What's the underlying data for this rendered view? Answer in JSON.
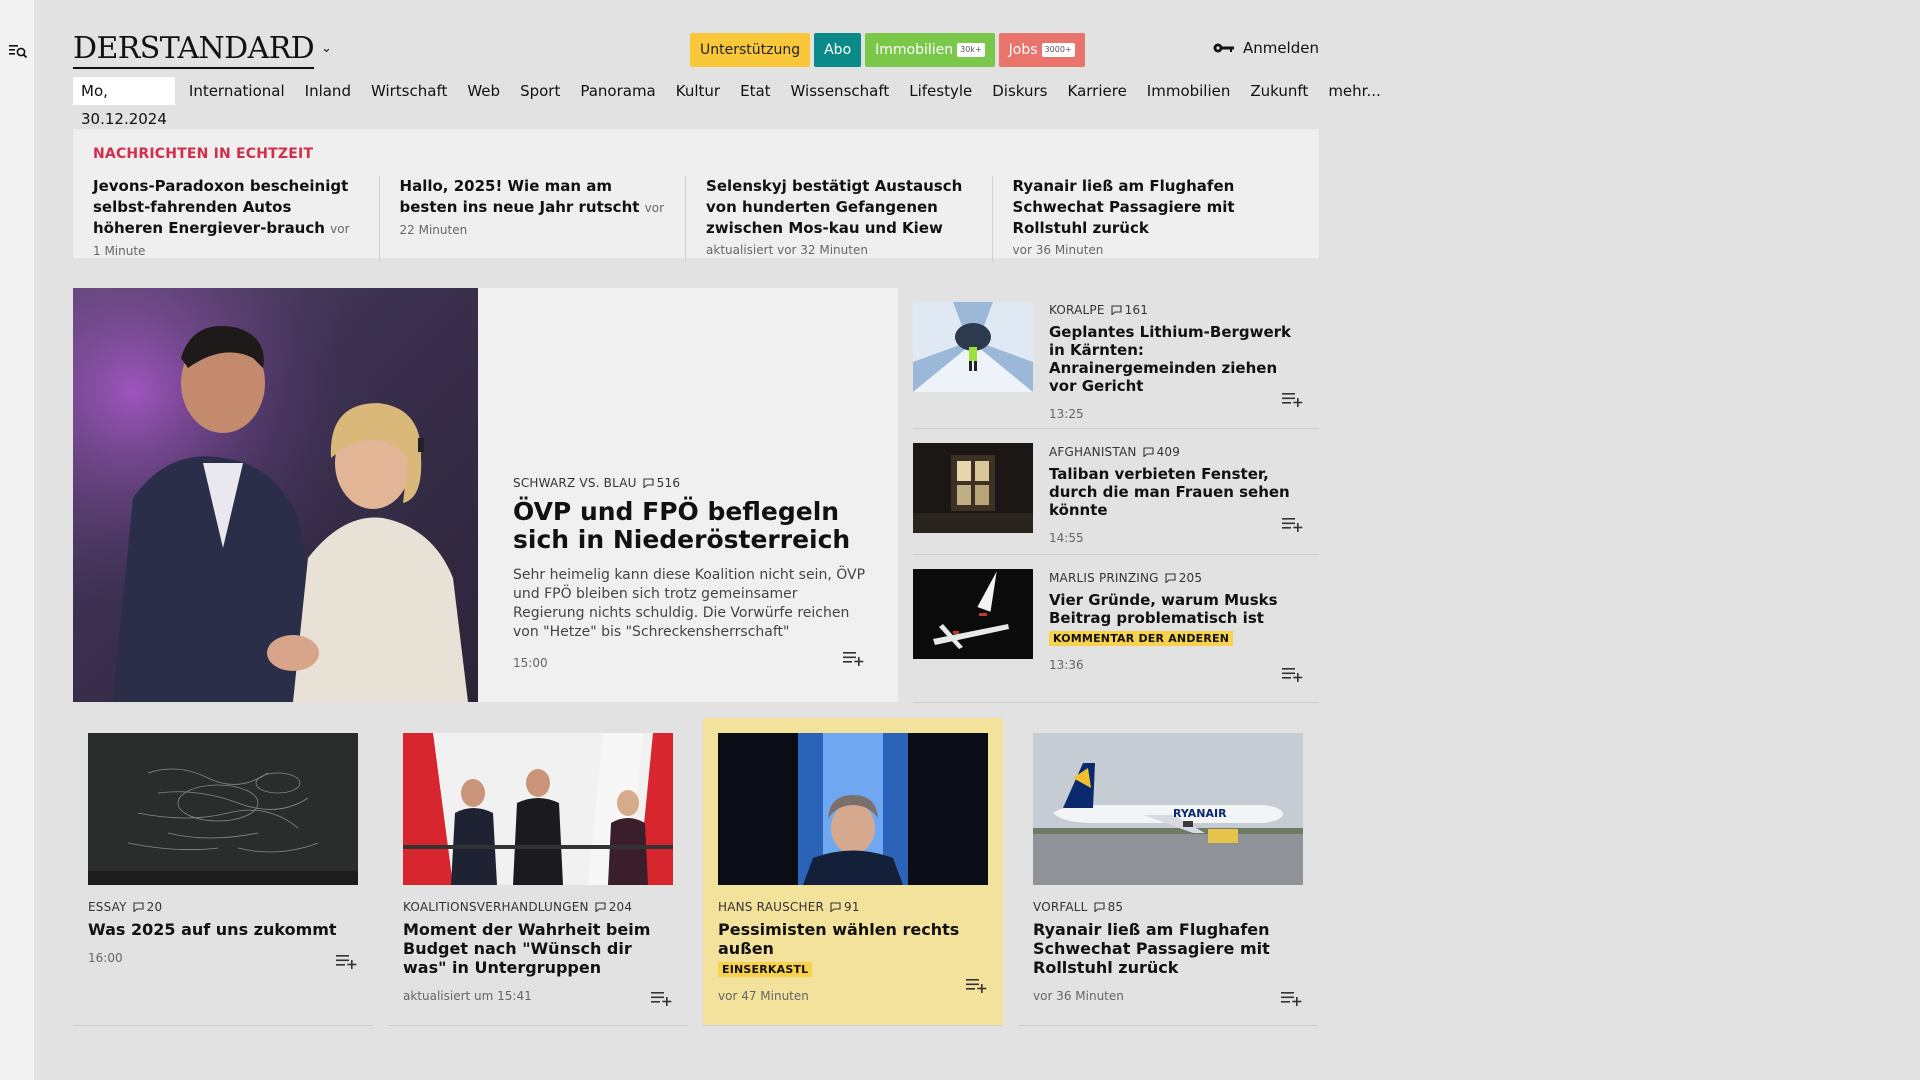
{
  "header": {
    "logo": "DERSTANDARD",
    "pills": {
      "support": "Unterstützung",
      "abo": "Abo",
      "immo": "Immobilien",
      "immo_tag": "30k+",
      "jobs": "Jobs",
      "jobs_tag": "3000+"
    },
    "login": "Anmelden"
  },
  "nav": {
    "date": "Mo, 30.12.2024",
    "items": [
      "International",
      "Inland",
      "Wirtschaft",
      "Web",
      "Sport",
      "Panorama",
      "Kultur",
      "Etat",
      "Wissenschaft",
      "Lifestyle",
      "Diskurs",
      "Karriere",
      "Immobilien",
      "Zukunft",
      "mehr..."
    ]
  },
  "live": {
    "label": "NACHRICHTEN IN ECHTZEIT",
    "items": [
      {
        "title": "Jevons-Paradoxon bescheinigt selbst-fahrenden Autos höheren Energiever-brauch",
        "time": "vor 1 Minute"
      },
      {
        "title": "Hallo, 2025! Wie man am besten ins neue Jahr rutscht",
        "time": "vor 22 Minuten"
      },
      {
        "title": "Selenskyj bestätigt Austausch von hunderten Gefangenen zwischen Mos-kau und Kiew",
        "time": "aktualisiert vor 32 Minuten"
      },
      {
        "title": "Ryanair ließ am Flughafen Schwechat Passagiere mit Rollstuhl zurück",
        "time": "vor 36 Minuten"
      }
    ]
  },
  "hero": {
    "kicker": "SCHWARZ VS. BLAU",
    "comments": "516",
    "title": "ÖVP und FPÖ beflegeln sich in Niederösterreich",
    "lead": "Sehr heimelig kann diese Koalition nicht sein, ÖVP und FPÖ bleiben sich trotz gemeinsamer Regierung nichts schuldig. Die Vorwürfe reichen von \"Hetze\" bis \"Schreckensherrschaft\"",
    "time": "15:00"
  },
  "side": [
    {
      "kicker": "KORALPE",
      "comments": "161",
      "title": "Geplantes Lithium-Bergwerk in Kärnten: Anrainergemeinden ziehen vor Gericht",
      "time": "13:25",
      "badge": ""
    },
    {
      "kicker": "AFGHANISTAN",
      "comments": "409",
      "title": "Taliban verbieten Fenster, durch die man Frauen sehen könnte",
      "time": "14:55",
      "badge": ""
    },
    {
      "kicker": "MARLIS PRINZING",
      "comments": "205",
      "title": "Vier Gründe, warum Musks Beitrag problematisch ist",
      "time": "13:36",
      "badge": "KOMMENTAR DER ANDEREN"
    }
  ],
  "cards": [
    {
      "kicker": "ESSAY",
      "comments": "20",
      "title": "Was 2025 auf uns zukommt",
      "time": "16:00",
      "badge": ""
    },
    {
      "kicker": "KOALITIONSVERHANDLUNGEN",
      "comments": "204",
      "title": "Moment der Wahrheit beim Budget nach \"Wünsch dir was\" in Untergruppen",
      "time": "aktualisiert um 15:41",
      "badge": ""
    },
    {
      "kicker": "HANS RAUSCHER",
      "comments": "91",
      "title": "Pessimisten wählen rechts außen",
      "time": "vor 47 Minuten",
      "badge": "EINSERKASTL"
    },
    {
      "kicker": "VORFALL",
      "comments": "85",
      "title": "Ryanair ließ am Flughafen Schwechat Passagiere mit Rollstuhl zurück",
      "time": "vor 36 Minuten",
      "badge": ""
    }
  ]
}
